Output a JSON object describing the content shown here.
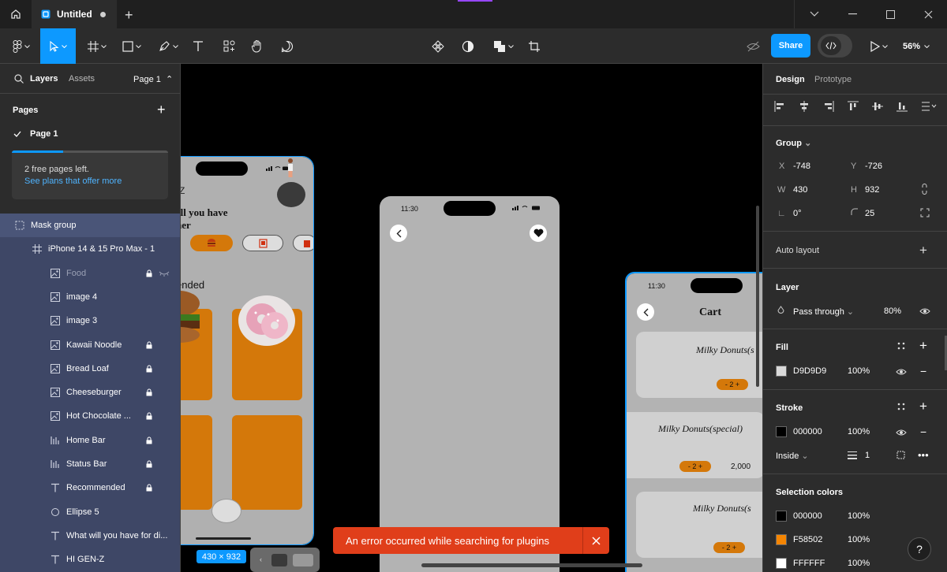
{
  "titlebar": {
    "tab_title": "Untitled"
  },
  "toolbar": {
    "share_label": "Share",
    "zoom_label": "56%"
  },
  "left_panel": {
    "tabs": {
      "layers": "Layers",
      "assets": "Assets",
      "page_select": "Page 1"
    },
    "pages_heading": "Pages",
    "current_page": "Page 1",
    "free_pages": {
      "line1": "2 free pages left.",
      "link": "See plans that offer more",
      "progress": 0.33
    },
    "layers": [
      {
        "name": "Mask group",
        "icon": "mask-icon",
        "locked": false,
        "indent": 0
      },
      {
        "name": "iPhone 14 & 15 Pro Max - 1",
        "icon": "frame-icon",
        "locked": false,
        "indent": 1
      },
      {
        "name": "Food",
        "icon": "image-icon",
        "locked": true,
        "hidden": true,
        "indent": 2
      },
      {
        "name": "image 4",
        "icon": "image-icon",
        "locked": false,
        "indent": 2
      },
      {
        "name": "image 3",
        "icon": "image-icon",
        "locked": false,
        "indent": 2
      },
      {
        "name": "Kawaii Noodle",
        "icon": "image-icon",
        "locked": true,
        "indent": 2
      },
      {
        "name": "Bread Loaf",
        "icon": "image-icon",
        "locked": true,
        "indent": 2
      },
      {
        "name": "Cheeseburger",
        "icon": "image-icon",
        "locked": true,
        "indent": 2
      },
      {
        "name": "Hot Chocolate ...",
        "icon": "image-icon",
        "locked": true,
        "indent": 2
      },
      {
        "name": "Home Bar",
        "icon": "bar-icon",
        "locked": true,
        "indent": 2
      },
      {
        "name": "Status Bar",
        "icon": "bar-icon",
        "locked": true,
        "indent": 2
      },
      {
        "name": "Recommended",
        "icon": "text-icon",
        "locked": true,
        "indent": 2
      },
      {
        "name": "Ellipse 5",
        "icon": "ellipse-icon",
        "locked": false,
        "indent": 2
      },
      {
        "name": "What will you have for di...",
        "icon": "text-icon",
        "locked": false,
        "indent": 2
      },
      {
        "name": "HI GEN-Z",
        "icon": "text-icon",
        "locked": false,
        "indent": 2
      }
    ]
  },
  "right_panel": {
    "tabs": {
      "design": "Design",
      "prototype": "Prototype"
    },
    "group": {
      "heading": "Group",
      "x_label": "X",
      "x": "-748",
      "y_label": "Y",
      "y": "-726",
      "w_label": "W",
      "w": "430",
      "h_label": "H",
      "h": "932",
      "rotation": "0°",
      "radius": "25"
    },
    "auto_layout": "Auto layout",
    "layer": {
      "heading": "Layer",
      "blend": "Pass through",
      "opacity": "80%"
    },
    "fill": {
      "heading": "Fill",
      "hex": "D9D9D9",
      "opacity": "100%",
      "color": "#D9D9D9"
    },
    "stroke": {
      "heading": "Stroke",
      "hex": "000000",
      "opacity": "100%",
      "color": "#000000",
      "position": "Inside",
      "weight": "1"
    },
    "selection_colors": {
      "heading": "Selection colors",
      "items": [
        {
          "hex": "000000",
          "opacity": "100%",
          "color": "#000000"
        },
        {
          "hex": "F58502",
          "opacity": "100%",
          "color": "#F58502"
        },
        {
          "hex": "FFFFFF",
          "opacity": "100%",
          "color": "#FFFFFF"
        }
      ]
    }
  },
  "canvas": {
    "phone1": {
      "greeting_initial": "Z",
      "heading_line1": "ill you have",
      "heading_line2": "ner",
      "section_label": "ended"
    },
    "phone2": {
      "time": "11:30"
    },
    "phone3": {
      "time": "11:30",
      "title": "Cart",
      "items": [
        {
          "title": "Milky Donuts(s",
          "qty": "- 2 +",
          "price": ""
        },
        {
          "title": "Milky Donuts(special)",
          "qty": "- 2 +",
          "price": "2,000"
        },
        {
          "title": "Milky Donuts(s",
          "qty": "- 2 +",
          "price": ""
        }
      ]
    },
    "size_badge": "430 × 932"
  },
  "toast": {
    "message": "An error occurred while searching for plugins"
  },
  "help_label": "?"
}
